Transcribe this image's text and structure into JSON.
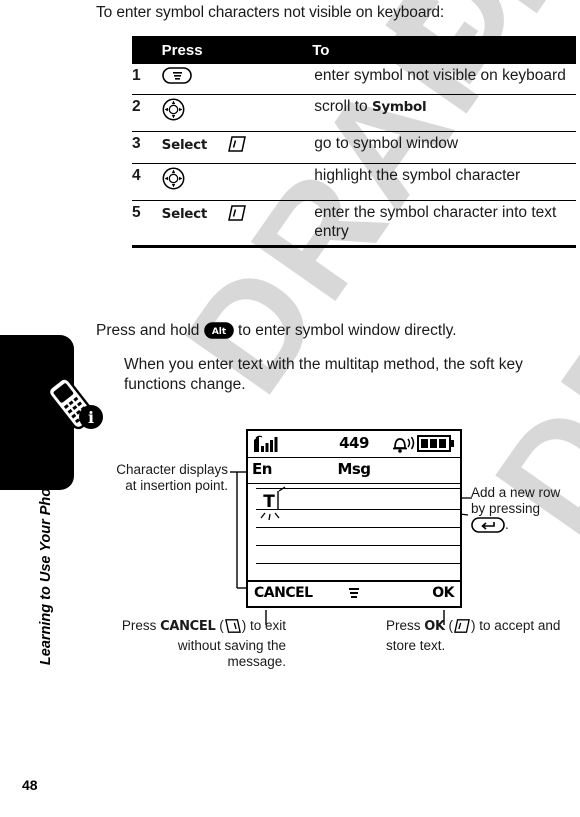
{
  "page": {
    "number": "48",
    "section_label": "Learning to Use Your Phone",
    "watermark": "DRAFT"
  },
  "intro": "To enter symbol characters not visible on keyboard:",
  "table": {
    "headers": {
      "num": "",
      "press": "Press",
      "to": "To"
    },
    "rows": [
      {
        "num": "1",
        "press_text": "",
        "press_icon": "menu-key-icon",
        "to": "enter symbol not visible on keyboard"
      },
      {
        "num": "2",
        "press_text": "",
        "press_icon": "navigation-key-icon",
        "to_prefix": "scroll to ",
        "to_bold": "Symbol"
      },
      {
        "num": "3",
        "press_text": "Select",
        "press_icon": "right-soft-key-icon",
        "to": "go to symbol window"
      },
      {
        "num": "4",
        "press_text": "",
        "press_icon": "navigation-key-icon",
        "to": "highlight the symbol character"
      },
      {
        "num": "5",
        "press_text": "Select",
        "press_icon": "right-soft-key-icon",
        "to": "enter the symbol character into text entry"
      }
    ]
  },
  "paragraphs": {
    "press_hold_before": "Press and hold ",
    "press_hold_icon": "alt-key-icon",
    "press_hold_after": " to enter symbol window directly.",
    "note": "When you enter text with the multitap method, the soft key functions change."
  },
  "figure": {
    "display": {
      "char_count": "449",
      "msg_label": "Msg",
      "entry_mode": "En",
      "cursor_char": "T",
      "softkey_left": "CANCEL",
      "softkey_center_icon": "menu-key-icon",
      "softkey_right": "OK",
      "status_icons": [
        "signal-strength-icon",
        "ringer-alert-icon",
        "battery-icon"
      ]
    },
    "callouts": {
      "character_insertion": "Character displays at insertion point.",
      "add_row_before": "Add a new row by pressing ",
      "add_row_icon": "enter-key-icon",
      "add_row_after": ".",
      "cancel_before": "Press ",
      "cancel_bold": "CANCEL",
      "cancel_icon": "left-soft-key-icon",
      "cancel_after": " to exit without saving the message.",
      "ok_before": "Press ",
      "ok_bold": "OK",
      "ok_icon": "right-soft-key-icon",
      "ok_after": " to accept and store text."
    }
  },
  "colors": {
    "ink": "#000000",
    "text": "#1a1a1a",
    "watermark": "#d8d8d8"
  }
}
